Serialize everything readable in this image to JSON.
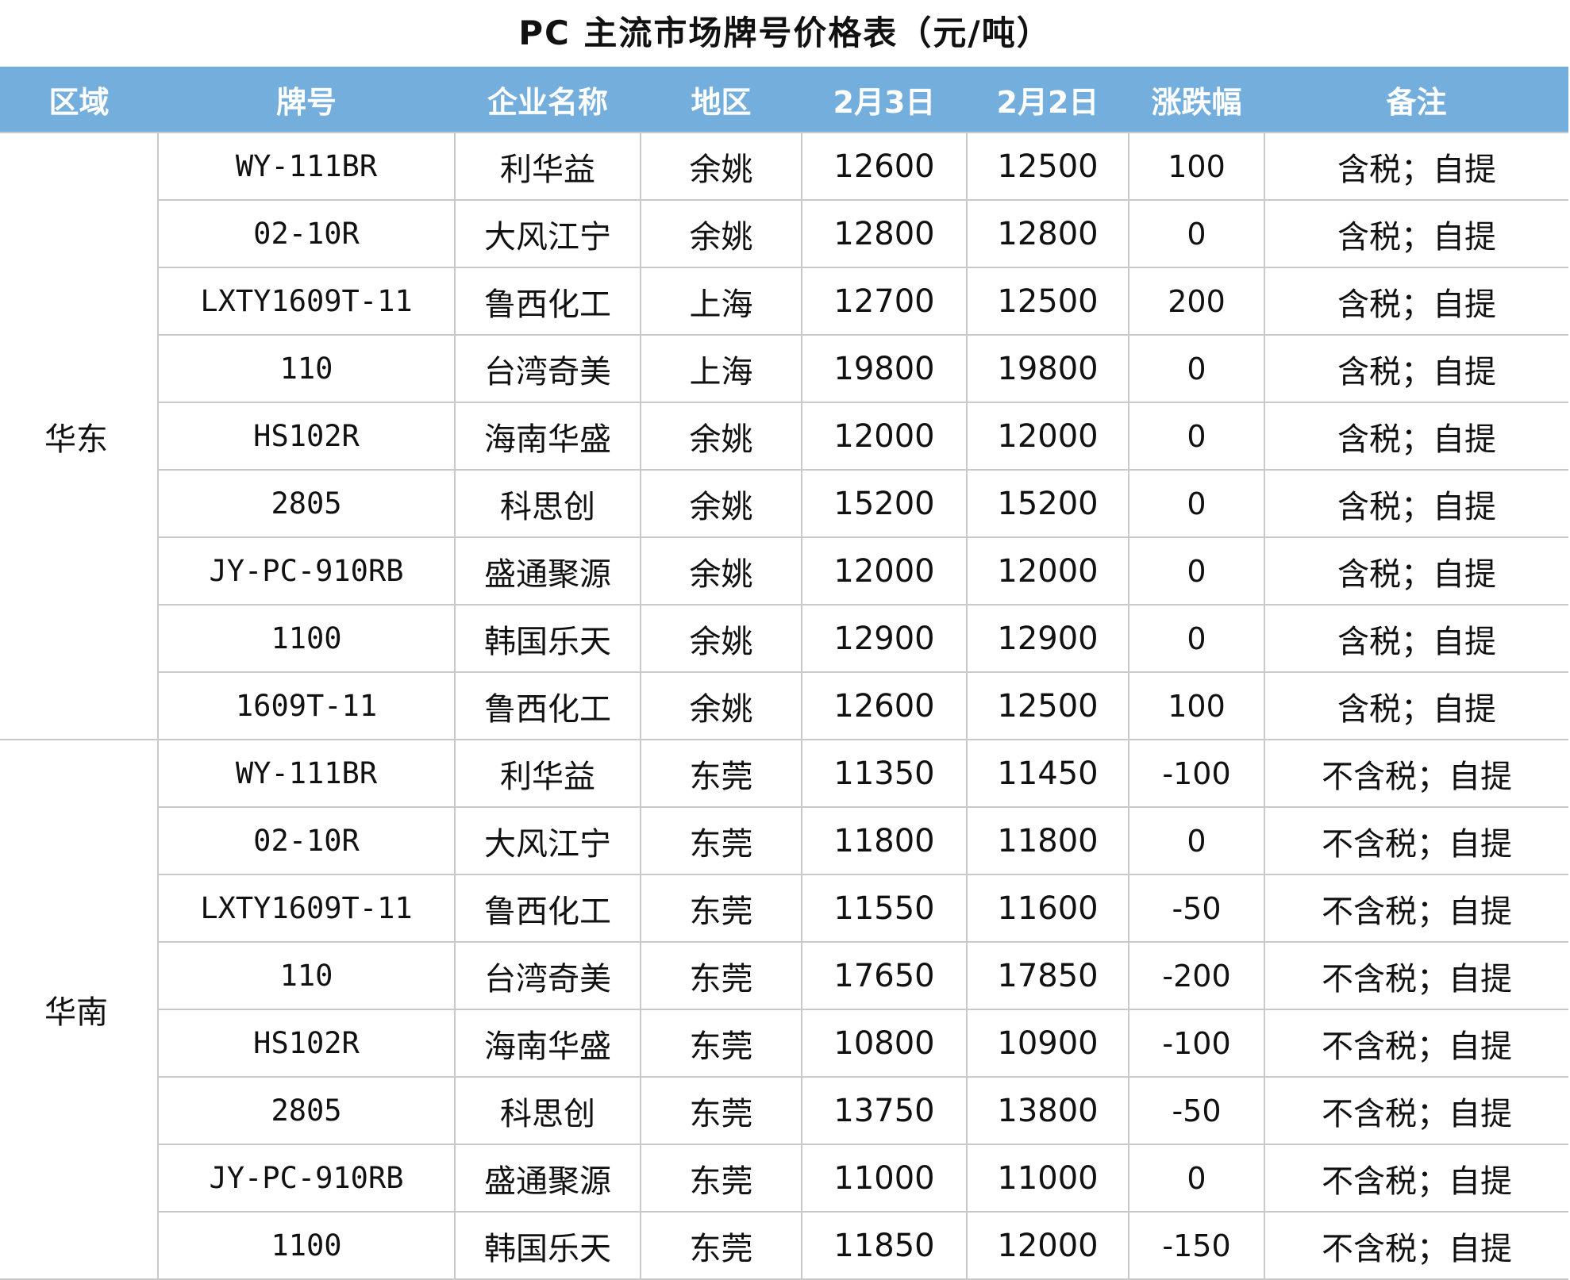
{
  "title": "PC 主流市场牌号价格表（元/吨）",
  "colors": {
    "header_bg": "#74aedd",
    "header_text": "#ffffff",
    "up": "#e0262b",
    "down": "#1aa032",
    "grid": "#c9c9c9"
  },
  "headers": [
    "区域",
    "牌号",
    "企业名称",
    "地区",
    "2月3日",
    "2月2日",
    "涨跌幅",
    "备注"
  ],
  "groups": [
    {
      "region": "华东",
      "rows": [
        {
          "grade": "WY-111BR",
          "company": "利华益",
          "area": "余姚",
          "d1": "12600",
          "d2": "12500",
          "change": "100",
          "note": "含税；自提"
        },
        {
          "grade": "02-10R",
          "company": "大风江宁",
          "area": "余姚",
          "d1": "12800",
          "d2": "12800",
          "change": "0",
          "note": "含税；自提"
        },
        {
          "grade": "LXTY1609T-11",
          "company": "鲁西化工",
          "area": "上海",
          "d1": "12700",
          "d2": "12500",
          "change": "200",
          "note": "含税；自提"
        },
        {
          "grade": "110",
          "company": "台湾奇美",
          "area": "上海",
          "d1": "19800",
          "d2": "19800",
          "change": "0",
          "note": "含税；自提"
        },
        {
          "grade": "HS102R",
          "company": "海南华盛",
          "area": "余姚",
          "d1": "12000",
          "d2": "12000",
          "change": "0",
          "note": "含税；自提"
        },
        {
          "grade": "2805",
          "company": "科思创",
          "area": "余姚",
          "d1": "15200",
          "d2": "15200",
          "change": "0",
          "note": "含税；自提"
        },
        {
          "grade": "JY-PC-910RB",
          "company": "盛通聚源",
          "area": "余姚",
          "d1": "12000",
          "d2": "12000",
          "change": "0",
          "note": "含税；自提"
        },
        {
          "grade": "1100",
          "company": "韩国乐天",
          "area": "余姚",
          "d1": "12900",
          "d2": "12900",
          "change": "0",
          "note": "含税；自提"
        },
        {
          "grade": "1609T-11",
          "company": "鲁西化工",
          "area": "余姚",
          "d1": "12600",
          "d2": "12500",
          "change": "100",
          "note": "含税；自提"
        }
      ]
    },
    {
      "region": "华南",
      "rows": [
        {
          "grade": "WY-111BR",
          "company": "利华益",
          "area": "东莞",
          "d1": "11350",
          "d2": "11450",
          "change": "-100",
          "note": "不含税；自提"
        },
        {
          "grade": "02-10R",
          "company": "大风江宁",
          "area": "东莞",
          "d1": "11800",
          "d2": "11800",
          "change": "0",
          "note": "不含税；自提"
        },
        {
          "grade": "LXTY1609T-11",
          "company": "鲁西化工",
          "area": "东莞",
          "d1": "11550",
          "d2": "11600",
          "change": "-50",
          "note": "不含税；自提"
        },
        {
          "grade": "110",
          "company": "台湾奇美",
          "area": "东莞",
          "d1": "17650",
          "d2": "17850",
          "change": "-200",
          "note": "不含税；自提"
        },
        {
          "grade": "HS102R",
          "company": "海南华盛",
          "area": "东莞",
          "d1": "10800",
          "d2": "10900",
          "change": "-100",
          "note": "不含税；自提"
        },
        {
          "grade": "2805",
          "company": "科思创",
          "area": "东莞",
          "d1": "13750",
          "d2": "13800",
          "change": "-50",
          "note": "不含税；自提"
        },
        {
          "grade": "JY-PC-910RB",
          "company": "盛通聚源",
          "area": "东莞",
          "d1": "11000",
          "d2": "11000",
          "change": "0",
          "note": "不含税；自提"
        },
        {
          "grade": "1100",
          "company": "韩国乐天",
          "area": "东莞",
          "d1": "11850",
          "d2": "12000",
          "change": "-150",
          "note": "不含税；自提"
        }
      ]
    }
  ]
}
